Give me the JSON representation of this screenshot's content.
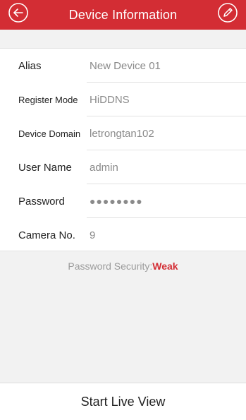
{
  "header": {
    "title": "Device Information",
    "back_icon": "back-arrow-circle-icon",
    "edit_icon": "pencil-circle-icon",
    "bg_color": "#d32d34"
  },
  "fields": [
    {
      "label": "Alias",
      "value": "New Device 01"
    },
    {
      "label": "Register Mode",
      "value": "HiDDNS"
    },
    {
      "label": "Device Domain",
      "value": "letrongtan102"
    },
    {
      "label": "User Name",
      "value": "admin"
    },
    {
      "label": "Password",
      "value": "●●●●●●●●"
    },
    {
      "label": "Camera No.",
      "value": "9"
    }
  ],
  "security": {
    "prefix": "Password Security:",
    "level": "Weak",
    "level_color": "#d32d34"
  },
  "bottom": {
    "button_label": "Start Live View"
  }
}
